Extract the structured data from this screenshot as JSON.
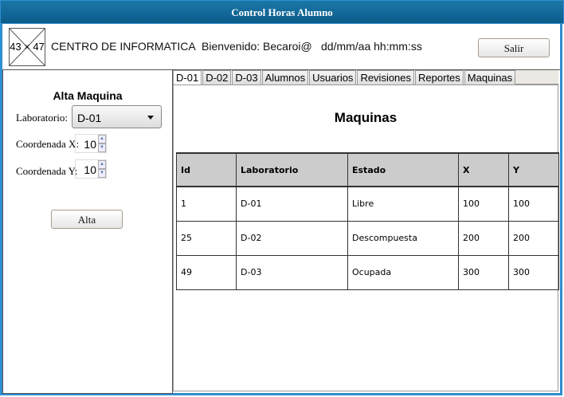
{
  "window": {
    "title": "Control Horas Alumno"
  },
  "header": {
    "logo_placeholder": "43 × 47",
    "org": "CENTRO DE INFORMATICA",
    "welcome": "Bienvenido: Becaroi@",
    "datetime": "dd/mm/aa hh:mm:ss",
    "logout_label": "Salir"
  },
  "form": {
    "title": "Alta Maquina",
    "lab_label": "Laboratorio:",
    "lab_value": "D-01",
    "x_label": "Coordenada X:",
    "x_value": "10",
    "y_label": "Coordenada Y:",
    "y_value": "10",
    "submit_label": "Alta"
  },
  "tabs": [
    {
      "label": "D-01",
      "active": true
    },
    {
      "label": "D-02"
    },
    {
      "label": "D-03"
    },
    {
      "label": "Alumnos"
    },
    {
      "label": "Usuarios"
    },
    {
      "label": "Revisiones"
    },
    {
      "label": "Reportes"
    },
    {
      "label": "Maquinas"
    }
  ],
  "main": {
    "title": "Maquinas",
    "columns": [
      "Id",
      "Laboratorio",
      "Estado",
      "X",
      "Y"
    ],
    "rows": [
      [
        "1",
        "D-01",
        "Libre",
        "100",
        "100"
      ],
      [
        "25",
        "D-02",
        "Descompuesta",
        "200",
        "200"
      ],
      [
        "49",
        "D-03",
        "Ocupada",
        "300",
        "300"
      ]
    ]
  }
}
